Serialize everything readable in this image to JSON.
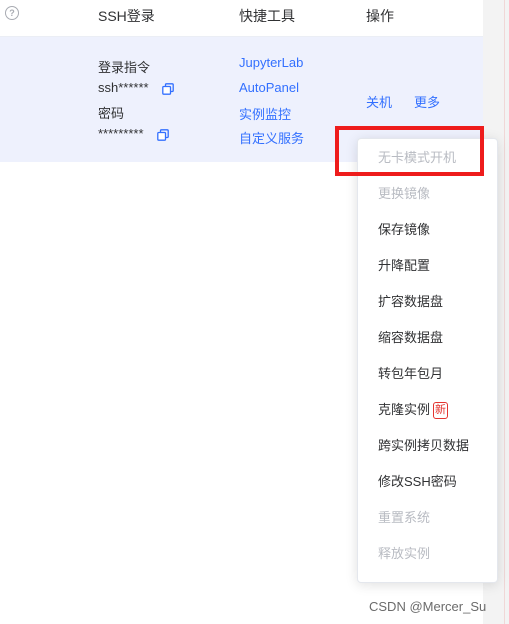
{
  "table": {
    "headers": {
      "ssh_login": "SSH登录",
      "quick_tools": "快捷工具",
      "actions": "操作"
    },
    "help_icon": "question-circle-icon",
    "row": {
      "ssh": {
        "login_cmd_label": "登录指令",
        "login_cmd_value": "ssh******",
        "password_label": "密码",
        "password_value": "*********"
      },
      "quick_tools": [
        "JupyterLab",
        "AutoPanel",
        "实例监控",
        "自定义服务"
      ],
      "actions": {
        "shutdown": "关机",
        "more": "更多"
      }
    }
  },
  "more_menu": {
    "items": [
      {
        "label": "无卡模式开机",
        "enabled": false
      },
      {
        "label": "更换镜像",
        "enabled": false
      },
      {
        "label": "保存镜像",
        "enabled": true
      },
      {
        "label": "升降配置",
        "enabled": true
      },
      {
        "label": "扩容数据盘",
        "enabled": true
      },
      {
        "label": "缩容数据盘",
        "enabled": true
      },
      {
        "label": "转包年包月",
        "enabled": true
      },
      {
        "label": "克隆实例",
        "enabled": true,
        "badge": "新"
      },
      {
        "label": "跨实例拷贝数据",
        "enabled": true
      },
      {
        "label": "修改SSH密码",
        "enabled": true
      },
      {
        "label": "重置系统",
        "enabled": false
      },
      {
        "label": "释放实例",
        "enabled": false
      }
    ]
  },
  "watermark": "CSDN @Mercer_Su",
  "colors": {
    "link": "#3370ff",
    "row_highlight": "#eef1fd",
    "annotation_box": "#ee1c1c",
    "badge": "#e3342f",
    "disabled_text": "#b8bbc2"
  }
}
